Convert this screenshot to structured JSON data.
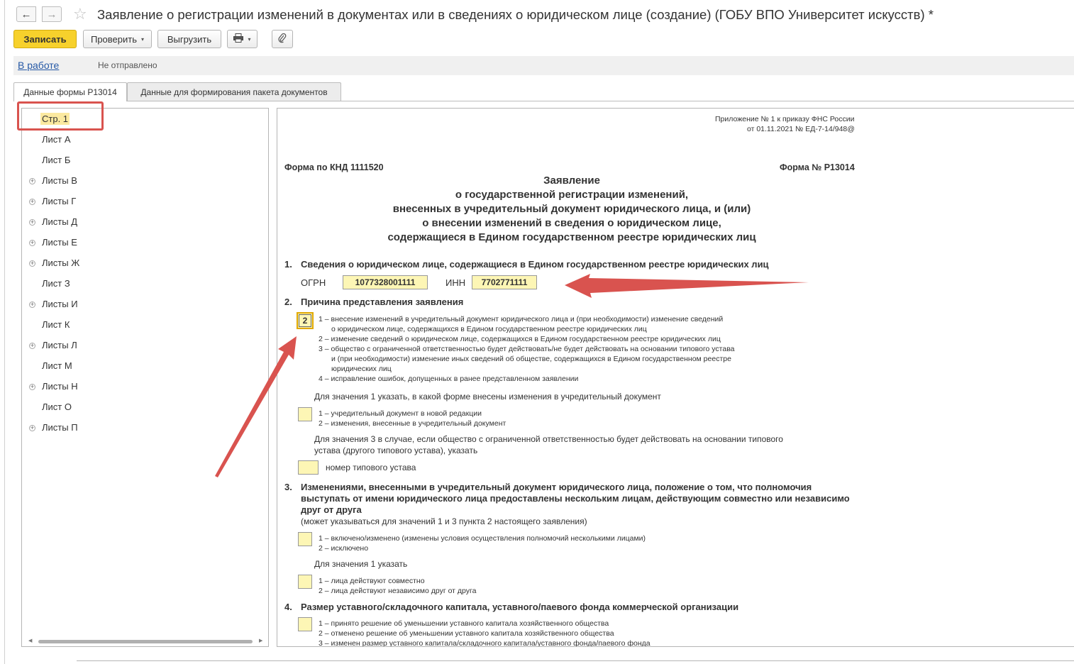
{
  "window": {
    "title": "Заявление о регистрации изменений в документах или в сведениях о юридическом лице (создание) (ГОБУ ВПО Университет искусств) *",
    "back_icon": "←",
    "forward_icon": "→",
    "star_icon": "☆"
  },
  "toolbar": {
    "save_label": "Записать",
    "check_label": "Проверить",
    "export_label": "Выгрузить",
    "print_icon": "🖶",
    "attach_icon": "📎",
    "caret": "▾"
  },
  "status": {
    "link": "В работе",
    "text": "Не отправлено"
  },
  "tabs": [
    {
      "label": "Данные формы Р13014",
      "active": true
    },
    {
      "label": "Данные для формирования пакета документов",
      "active": false
    }
  ],
  "tree": {
    "items": [
      {
        "label": "Стр. 1",
        "expandable": false,
        "selected": true
      },
      {
        "label": "Лист А",
        "expandable": false
      },
      {
        "label": "Лист Б",
        "expandable": false
      },
      {
        "label": "Листы В",
        "expandable": true
      },
      {
        "label": "Листы Г",
        "expandable": true
      },
      {
        "label": "Листы Д",
        "expandable": true
      },
      {
        "label": "Листы Е",
        "expandable": true
      },
      {
        "label": "Листы Ж",
        "expandable": true
      },
      {
        "label": "Лист З",
        "expandable": false
      },
      {
        "label": "Листы И",
        "expandable": true
      },
      {
        "label": "Лист К",
        "expandable": false
      },
      {
        "label": "Листы Л",
        "expandable": true
      },
      {
        "label": "Лист М",
        "expandable": false
      },
      {
        "label": "Листы Н",
        "expandable": true
      },
      {
        "label": "Лист О",
        "expandable": false
      },
      {
        "label": "Листы П",
        "expandable": true
      }
    ],
    "plus_glyph": "+"
  },
  "form": {
    "appendix_line1": "Приложение № 1 к приказу ФНС России",
    "appendix_line2": "от 01.11.2021 № ЕД-7-14/948@",
    "knd": "Форма по КНД 1111520",
    "form_no": "Форма № Р13014",
    "title_lines": [
      "Заявление",
      "о государственной регистрации изменений,",
      "внесенных в учредительный документ юридического лица, и (или)",
      "о внесении изменений в сведения о юридическом лице,",
      "содержащиеся в Едином государственном реестре юридических лиц"
    ],
    "s1_num": "1.",
    "s1_title": "Сведения о юридическом лице, содержащиеся в Едином государственном реестре юридических лиц",
    "ogrn_label": "ОГРН",
    "ogrn_value": "1077328001111",
    "inn_label": "ИНН",
    "inn_value": "7702771111",
    "s2_num": "2.",
    "s2_title": "Причина представления заявления",
    "reason_value": "2",
    "reason_lines": [
      "1 – внесение изменений в учредительный документ юридического лица и (при необходимости) изменение сведений",
      "о юридическом лице, содержащихся в Едином государственном реестре юридических лиц",
      "2 – изменение сведений о юридическом лице, содержащихся в Едином государственном реестре юридических лиц",
      "3 – общество с ограниченной ответственностью будет действовать/не будет действовать на основании типового устава",
      "и (при необходимости) изменение иных сведений об обществе, содержащихся в Едином государственном реестре",
      "юридических лиц",
      "4 – исправление ошибок, допущенных в ранее представленном заявлении"
    ],
    "for_value1": "Для значения 1 указать, в какой форме внесены изменения в учредительный документ",
    "form_option_lines": [
      "1 – учредительный документ в новой редакции",
      "2 – изменения, внесенные в учредительный документ"
    ],
    "for_value3_line1": "Для значения 3 в случае, если общество с ограниченной ответственностью будет действовать на основании типового",
    "for_value3_line2": "устава (другого типового устава), указать",
    "charter_no_label": "номер типового устава",
    "s3_num": "3.",
    "s3_title_lines": [
      "Изменениями, внесенными в учредительный документ юридического лица, положение о том, что полномочия",
      "выступать от имени юридического лица предоставлены нескольким лицам, действующим совместно или независимо",
      "друг от друга"
    ],
    "s3_note": "(может указываться для значений 1 и 3 пункта 2 настоящего заявления)",
    "s3_option_lines": [
      "1 – включено/изменено (изменены условия осуществления полномочий несколькими лицами)",
      "2 – исключено"
    ],
    "s3_for_value1": "Для значения 1 указать",
    "s3_sub_lines": [
      "1 – лица действуют совместно",
      "2 – лица действуют независимо друг от друга"
    ],
    "s4_num": "4.",
    "s4_title": "Размер уставного/складочного капитала, уставного/паевого фонда коммерческой организации",
    "s4_lines": [
      "1 – принято решение об уменьшении уставного капитала хозяйственного общества",
      "2 – отменено решение об уменьшении уставного капитала хозяйственного общества",
      "3 – изменен размер уставного капитала/складочного капитала/уставного фонда/паевого фонда"
    ]
  },
  "colors": {
    "primary_button": "#f7d12c",
    "field_fill": "#fdf6b5",
    "annotation": "#d9534f",
    "link": "#2659a6"
  }
}
